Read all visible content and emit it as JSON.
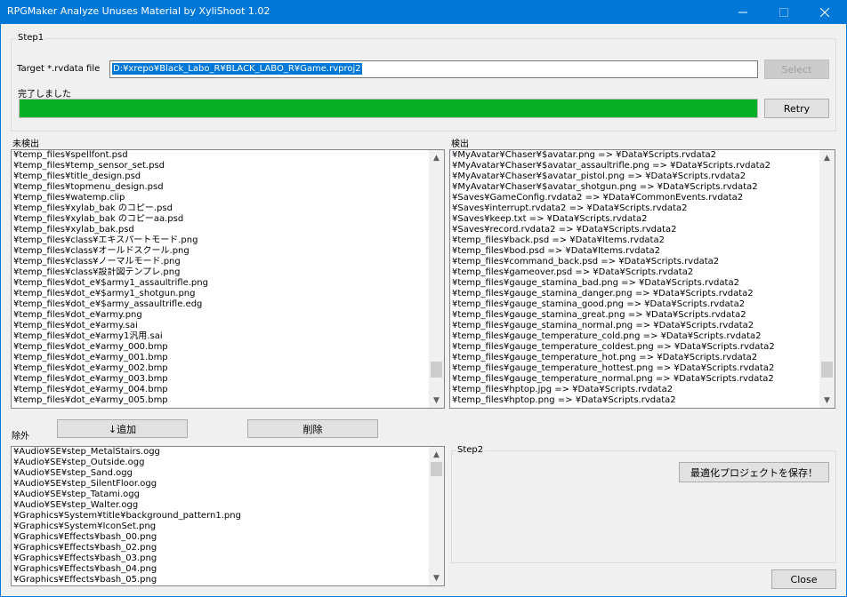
{
  "window": {
    "title": "RPGMaker Analyze Unuses Material  by XyliShoot 1.02",
    "controls": {
      "minimize": "—",
      "maximize": "☐",
      "close": "✕"
    }
  },
  "step1": {
    "legend": "Step1",
    "target_label": "Target *.rvdata file",
    "target_value": "D:¥xrepo¥Black_Labo_R¥BLACK_LABO_R¥Game.rvproj2",
    "select_label": "Select",
    "status_text": "完了しました",
    "progress": 1.0,
    "retry_label": "Retry"
  },
  "unused": {
    "label": "未検出",
    "items": [
      "¥temp_files¥spellfont.psd",
      "¥temp_files¥temp_sensor_set.psd",
      "¥temp_files¥title_design.psd",
      "¥temp_files¥topmenu_design.psd",
      "¥temp_files¥watemp.clip",
      "¥temp_files¥xylab_bak のコピー.psd",
      "¥temp_files¥xylab_bak のコピーaa.psd",
      "¥temp_files¥xylab_bak.psd",
      "¥temp_files¥class¥エキスパートモード.png",
      "¥temp_files¥class¥オールドスクール.png",
      "¥temp_files¥class¥ノーマルモード.png",
      "¥temp_files¥class¥設計図テンプレ.png",
      "¥temp_files¥dot_e¥$army1_assaultrifle.png",
      "¥temp_files¥dot_e¥$army1_shotgun.png",
      "¥temp_files¥dot_e¥$army_assaultrifle.edg",
      "¥temp_files¥dot_e¥army.png",
      "¥temp_files¥dot_e¥army.sai",
      "¥temp_files¥dot_e¥army1汎用.sai",
      "¥temp_files¥dot_e¥army_000.bmp",
      "¥temp_files¥dot_e¥army_001.bmp",
      "¥temp_files¥dot_e¥army_002.bmp",
      "¥temp_files¥dot_e¥army_003.bmp",
      "¥temp_files¥dot_e¥army_004.bmp",
      "¥temp_files¥dot_e¥army_005.bmp"
    ],
    "scroll_fraction": 0.93
  },
  "detected": {
    "label": "検出",
    "items": [
      "¥MyAvatar¥Chaser¥$avatar.png => ¥Data¥Scripts.rvdata2",
      "¥MyAvatar¥Chaser¥$avatar_assaultrifle.png => ¥Data¥Scripts.rvdata2",
      "¥MyAvatar¥Chaser¥$avatar_pistol.png => ¥Data¥Scripts.rvdata2",
      "¥MyAvatar¥Chaser¥$avatar_shotgun.png => ¥Data¥Scripts.rvdata2",
      "¥Saves¥GameConfig.rvdata2 => ¥Data¥CommonEvents.rvdata2",
      "¥Saves¥interrupt.rvdata2 => ¥Data¥Scripts.rvdata2",
      "¥Saves¥keep.txt => ¥Data¥Scripts.rvdata2",
      "¥Saves¥record.rvdata2 => ¥Data¥Scripts.rvdata2",
      "¥temp_files¥back.psd => ¥Data¥Items.rvdata2",
      "¥temp_files¥bod.psd => ¥Data¥Items.rvdata2",
      "¥temp_files¥command_back.psd => ¥Data¥Scripts.rvdata2",
      "¥temp_files¥gameover.psd => ¥Data¥Scripts.rvdata2",
      "¥temp_files¥gauge_stamina_bad.png => ¥Data¥Scripts.rvdata2",
      "¥temp_files¥gauge_stamina_danger.png => ¥Data¥Scripts.rvdata2",
      "¥temp_files¥gauge_stamina_good.png => ¥Data¥Scripts.rvdata2",
      "¥temp_files¥gauge_stamina_great.png => ¥Data¥Scripts.rvdata2",
      "¥temp_files¥gauge_stamina_normal.png => ¥Data¥Scripts.rvdata2",
      "¥temp_files¥gauge_temperature_cold.png => ¥Data¥Scripts.rvdata2",
      "¥temp_files¥gauge_temperature_coldest.png => ¥Data¥Scripts.rvdata2",
      "¥temp_files¥gauge_temperature_hot.png => ¥Data¥Scripts.rvdata2",
      "¥temp_files¥gauge_temperature_hottest.png => ¥Data¥Scripts.rvdata2",
      "¥temp_files¥gauge_temperature_normal.png => ¥Data¥Scripts.rvdata2",
      "¥temp_files¥hptop.jpg => ¥Data¥Scripts.rvdata2",
      "¥temp_files¥hptop.png => ¥Data¥Scripts.rvdata2"
    ],
    "scroll_fraction": 0.93
  },
  "exclude": {
    "label": "除外",
    "add_label": "↓追加",
    "delete_label": "削除",
    "items": [
      "¥Audio¥SE¥step_MetalStairs.ogg",
      "¥Audio¥SE¥step_Outside.ogg",
      "¥Audio¥SE¥step_Sand.ogg",
      "¥Audio¥SE¥step_SilentFloor.ogg",
      "¥Audio¥SE¥step_Tatami.ogg",
      "¥Audio¥SE¥step_Walter.ogg",
      "¥Graphics¥System¥title¥background_pattern1.png",
      "¥Graphics¥System¥IconSet.png",
      "¥Graphics¥Effects¥bash_00.png",
      "¥Graphics¥Effects¥bash_02.png",
      "¥Graphics¥Effects¥bash_03.png",
      "¥Graphics¥Effects¥bash_04.png",
      "¥Graphics¥Effects¥bash_05.png"
    ],
    "scroll_fraction": 0.0
  },
  "step2": {
    "legend": "Step2",
    "save_label": "最適化プロジェクトを保存！"
  },
  "footer": {
    "close_label": "Close"
  }
}
